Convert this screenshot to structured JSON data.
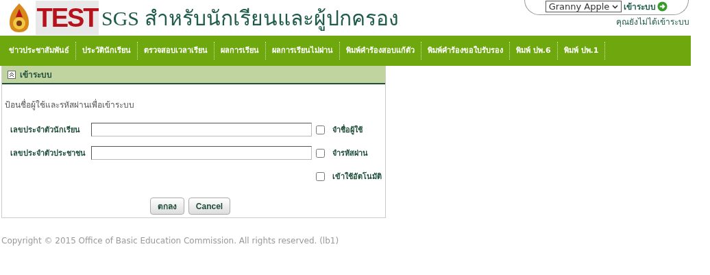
{
  "header": {
    "logo_text": "TEST",
    "title": "SGS สำหรับนักเรียนและผู้ปกครอง"
  },
  "account": {
    "user_select": "Granny Apple",
    "login_button": "เข้าระบบ",
    "status": "คุณยังไม่ได้เข้าระบบ"
  },
  "nav": [
    {
      "label": "ข่าวประชาสัมพันธ์"
    },
    {
      "label": "ประวัตินักเรียน"
    },
    {
      "label": "ตรวจสอบเวลาเรียน"
    },
    {
      "label": "ผลการเรียน"
    },
    {
      "label": "ผลการเรียนไม่ผ่าน"
    },
    {
      "label": "พิมพ์คำร้องสอบแก้ตัว"
    },
    {
      "label": "พิมพ์คำร้องขอใบรับรอง"
    },
    {
      "label": "พิมพ์ ปพ.6"
    },
    {
      "label": "พิมพ์ ปพ.1"
    }
  ],
  "panel": {
    "title": "เข้าระบบ",
    "expanded": true,
    "instruction": "ป้อนชื่อผู้ใช้และรหัสผ่านเพื่อเข้าระบบ",
    "fields": [
      {
        "label": "เลขประจำตัวนักเรียน",
        "option": "จำชื่อผู้ใช้",
        "checked": false
      },
      {
        "label": "เลขประจำตัวประชาชน",
        "option": "จำรหัสผ่าน",
        "checked": false
      }
    ],
    "extra_option": {
      "label": "เข้าใช้อัตโนมัติ",
      "checked": false
    },
    "buttons": [
      "ตกลง",
      "Cancel"
    ]
  },
  "footer": "Copyright © 2015 Office of Basic Education Commission. All rights reserved. (lb1)"
}
